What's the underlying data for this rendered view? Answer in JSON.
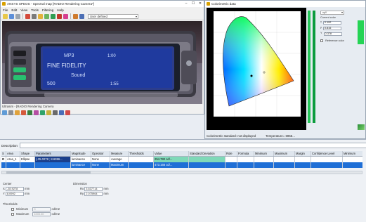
{
  "spectral_window": {
    "title": "ANSYS SPEOS - Spectral map [RADIO Rendering Camera*]",
    "menu": [
      "File",
      "Edit",
      "View",
      "Tools",
      "Filtering",
      "Help"
    ],
    "preset": "User defined",
    "display_lines": [
      "MP3",
      "FINE FIDELITY",
      "Sound",
      "500",
      "1:00",
      "1:55"
    ],
    "subtitle": "Ultrasim - [RADIO Rendering Camera"
  },
  "colorimetric": {
    "title": "Colorimetric data",
    "space": "xyY",
    "current_color_label": "Current color",
    "x_label": "x",
    "x_value": "0.192",
    "y_label": "y",
    "y_value": "0.815",
    "Y_label": "Y",
    "Y_value": "0.378",
    "reference_label": "Reference color",
    "status_standard": "Colorimetric standard: not displayed",
    "status_temp": "Temperature= 6955..."
  },
  "bottom": {
    "description_label": "Description",
    "columns": [
      "S",
      "Area",
      "Shape",
      "Parameters",
      "Magnitude",
      "Operator",
      "Measure",
      "Thresholds",
      "Value",
      "Standard Deviation",
      "Role",
      "Formula",
      "Minimum",
      "Maximum",
      "Margin",
      "Confidence Level",
      "Minimum"
    ],
    "rows": [
      [
        "",
        "Area_1",
        "Ellipse",
        "(-35.0278 ; 8.6996...",
        "luminance",
        "None",
        "Average",
        "",
        "254.782 cd/...",
        "",
        "",
        "",
        "",
        "",
        "",
        "",
        ""
      ],
      [
        "",
        "",
        "",
        "",
        "luminance",
        "None",
        "Maximum",
        "",
        "473.166 cd/...",
        "",
        "",
        "",
        "",
        "",
        "",
        "",
        ""
      ]
    ],
    "center_label": "Center",
    "center_x_label": "X",
    "center_x": "-35.9278",
    "center_y_label": "Y",
    "center_y": "8.0992",
    "unit_mm": "mm",
    "dimension_label": "Dimension",
    "rx_label": "Rx",
    "rx": "3.637714",
    "ry_label": "Ry",
    "ry": "2.075964",
    "thresholds_label": "Thresholds",
    "minimum_label": "Minimum",
    "minimum_value": "0",
    "maximum_label": "Maximum",
    "maximum_value": "1000.00",
    "unit_lum": "cd/m2"
  },
  "colors": {
    "accent_selection": "#1f6fd6",
    "value_highlight": "#7fd9b8",
    "param_highlight": "#1a3f8c"
  }
}
